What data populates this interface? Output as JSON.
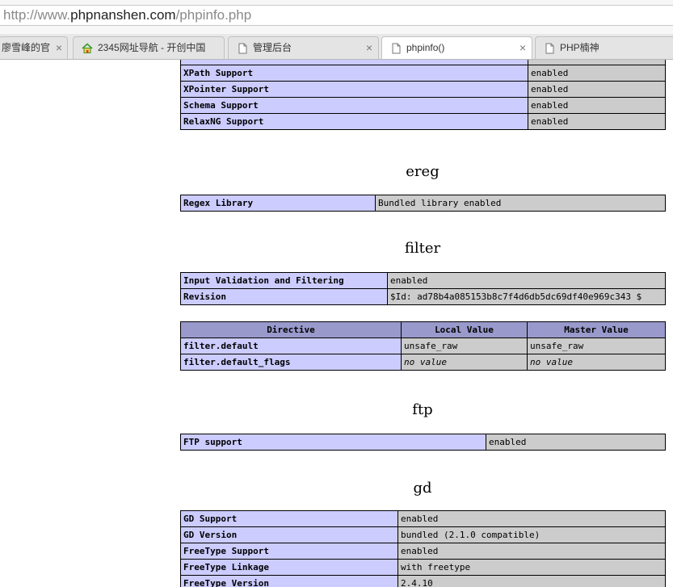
{
  "browser": {
    "url": {
      "scheme": "http://www.",
      "host": "phpnanshen.com",
      "path": "/phpinfo.php"
    },
    "tabs": [
      {
        "label": "廖雪峰的官",
        "icon": "none"
      },
      {
        "label": "2345网址导航 - 开创中国",
        "icon": "house-icon"
      },
      {
        "label": "管理后台",
        "icon": "page-icon"
      },
      {
        "label": "phpinfo()",
        "icon": "page-icon",
        "active": true
      },
      {
        "label": "PHP楠神",
        "icon": "page-icon"
      }
    ],
    "close_glyph": "×"
  },
  "phpinfo": {
    "libxml_rows": [
      [
        "XPath Support",
        "enabled"
      ],
      [
        "XPointer Support",
        "enabled"
      ],
      [
        "Schema Support",
        "enabled"
      ],
      [
        "RelaxNG Support",
        "enabled"
      ]
    ],
    "ereg": {
      "title": "ereg",
      "rows": [
        [
          "Regex Library",
          "Bundled library enabled"
        ]
      ]
    },
    "filter": {
      "title": "filter",
      "rows": [
        [
          "Input Validation and Filtering",
          "enabled"
        ],
        [
          "Revision",
          "$Id: ad78b4a085153b8c7f4d6db5dc69df40e969c343 $"
        ]
      ],
      "directive_headers": [
        "Directive",
        "Local Value",
        "Master Value"
      ],
      "directives": [
        [
          "filter.default",
          "unsafe_raw",
          "unsafe_raw"
        ],
        [
          "filter.default_flags",
          "no value",
          "no value"
        ]
      ]
    },
    "ftp": {
      "title": "ftp",
      "rows": [
        [
          "FTP support",
          "enabled"
        ]
      ]
    },
    "gd": {
      "title": "gd",
      "rows": [
        [
          "GD Support",
          "enabled"
        ],
        [
          "GD Version",
          "bundled (2.1.0 compatible)"
        ],
        [
          "FreeType Support",
          "enabled"
        ],
        [
          "FreeType Linkage",
          "with freetype"
        ],
        [
          "FreeType Version",
          "2.4.10"
        ]
      ]
    }
  }
}
